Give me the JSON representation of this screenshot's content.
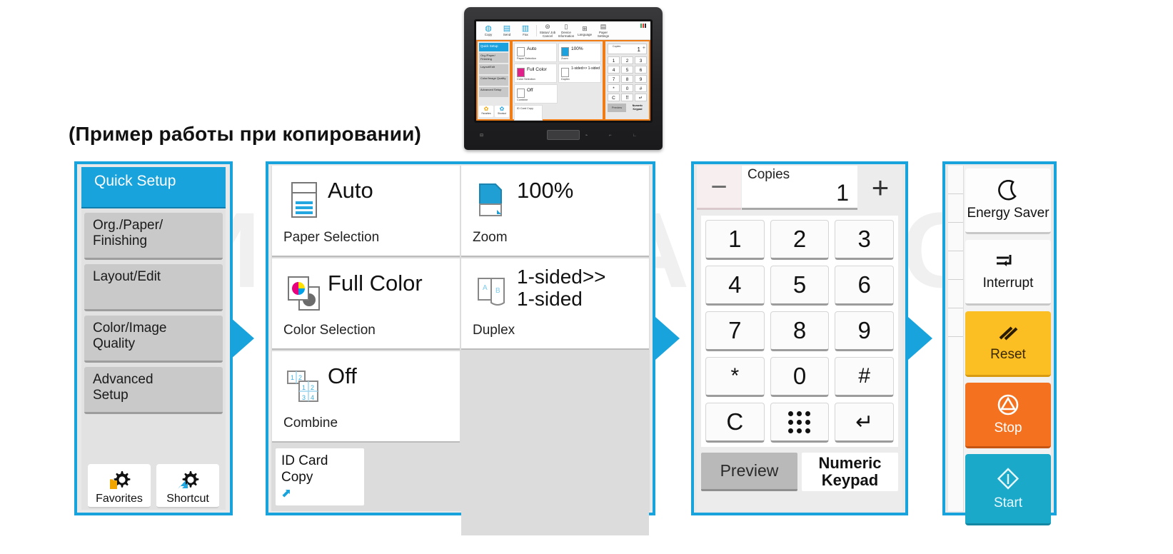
{
  "caption": "(Пример работы при копировании)",
  "watermark": "КИОСЕРА.РУС",
  "device": {
    "screen_title": "Copy",
    "toolbar": [
      {
        "label": "Copy",
        "icon": "copy-icon"
      },
      {
        "label": "Send",
        "icon": "send-icon"
      },
      {
        "label": "Fax",
        "icon": "fax-icon"
      },
      {
        "label": "Status/\nJob Cancel",
        "icon": "status-icon"
      },
      {
        "label": "Device\nInformation",
        "icon": "info-icon"
      },
      {
        "label": "Language",
        "icon": "language-icon"
      },
      {
        "label": "Paper Settings",
        "icon": "paper-settings-icon"
      }
    ]
  },
  "panel1": {
    "active_tab": "Quick Setup",
    "menu_items": [
      "Org./Paper/\nFinishing",
      "Layout/Edit",
      "Color/Image\nQuality",
      "Advanced\nSetup"
    ],
    "bottom_buttons": [
      {
        "label": "Favorites",
        "icon": "gear-star-icon"
      },
      {
        "label": "Shortcut",
        "icon": "gear-arrow-icon"
      }
    ]
  },
  "panel2": {
    "tiles": [
      {
        "value": "Auto",
        "label": "Paper Selection",
        "icon": "paper-tray-icon"
      },
      {
        "value": "100%",
        "label": "Zoom",
        "icon": "zoom-page-icon"
      },
      {
        "value": "Full Color",
        "label": "Color Selection",
        "icon": "color-selection-icon"
      },
      {
        "value": "1-sided>>\n1-sided",
        "label": "Duplex",
        "icon": "duplex-icon"
      },
      {
        "value": "Off",
        "label": "Combine",
        "icon": "combine-icon"
      }
    ],
    "id_card": {
      "label": "ID Card\nCopy",
      "icon": "shortcut-arrow-icon"
    }
  },
  "panel3": {
    "copies_label": "Copies",
    "copies_value": "1",
    "minus_label": "−",
    "plus_label": "+",
    "keys": [
      "1",
      "2",
      "3",
      "4",
      "5",
      "6",
      "7",
      "8",
      "9",
      "*",
      "0",
      "#",
      "C",
      "keypad-dots-icon",
      "↵"
    ],
    "preview_label": "Preview",
    "numeric_keypad_line1": "Numeric",
    "numeric_keypad_line2": "Keypad"
  },
  "panel4": {
    "keys": [
      {
        "label": "Energy Saver",
        "icon": "moon-icon",
        "color": "#fdfdfd"
      },
      {
        "label": "Interrupt",
        "icon": "interrupt-icon",
        "color": "#fdfdfd"
      },
      {
        "label": "Reset",
        "icon": "reset-slashes-icon",
        "color": "#fbbf24"
      },
      {
        "label": "Stop",
        "icon": "stop-circle-icon",
        "color": "#f4711f"
      },
      {
        "label": "Start",
        "icon": "start-diamond-icon",
        "color": "#1aa9c9"
      }
    ]
  },
  "colors": {
    "accent_blue": "#19a3dc",
    "orange_frame": "#f07c16",
    "reset_yellow": "#fbbf24",
    "stop_orange": "#f4711f",
    "start_teal": "#1aa9c9",
    "panel_gray": "#e2e2e2"
  }
}
